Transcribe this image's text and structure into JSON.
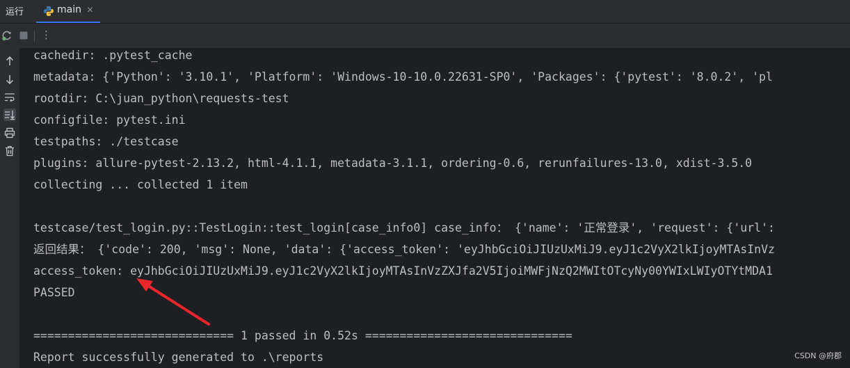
{
  "header": {
    "run_label": "运行",
    "tab_label": "main",
    "close_glyph": "×"
  },
  "toolbar": {
    "more_glyph": "⋮"
  },
  "console": {
    "lines": [
      "cachedir: .pytest_cache",
      "metadata: {'Python': '3.10.1', 'Platform': 'Windows-10-10.0.22631-SP0', 'Packages': {'pytest': '8.0.2', 'pl",
      "rootdir: C:\\juan_python\\requests-test",
      "configfile: pytest.ini",
      "testpaths: ./testcase",
      "plugins: allure-pytest-2.13.2, html-4.1.1, metadata-3.1.1, ordering-0.6, rerunfailures-13.0, xdist-3.5.0",
      "collecting ... collected 1 item",
      "",
      "testcase/test_login.py::TestLogin::test_login[case_info0] case_info： {'name': '正常登录', 'request': {'url':",
      "返回结果： {'code': 200, 'msg': None, 'data': {'access_token': 'eyJhbGciOiJIUzUxMiJ9.eyJ1c2VyX2lkIjoyMTAsInVz",
      "access_token: eyJhbGciOiJIUzUxMiJ9.eyJ1c2VyX2lkIjoyMTAsInVzZXJfa2V5IjoiMWFjNzQ2MWItOTcyNy00YWIxLWIyOTYtMDA1",
      "PASSED",
      "",
      "============================= 1 passed in 0.52s ==============================",
      "Report successfully generated to .\\reports"
    ]
  },
  "watermark": "CSDN @府郡",
  "colors": {
    "accent": "#3574f0",
    "arrow": "#e8262b",
    "text": "#bcbec4"
  }
}
